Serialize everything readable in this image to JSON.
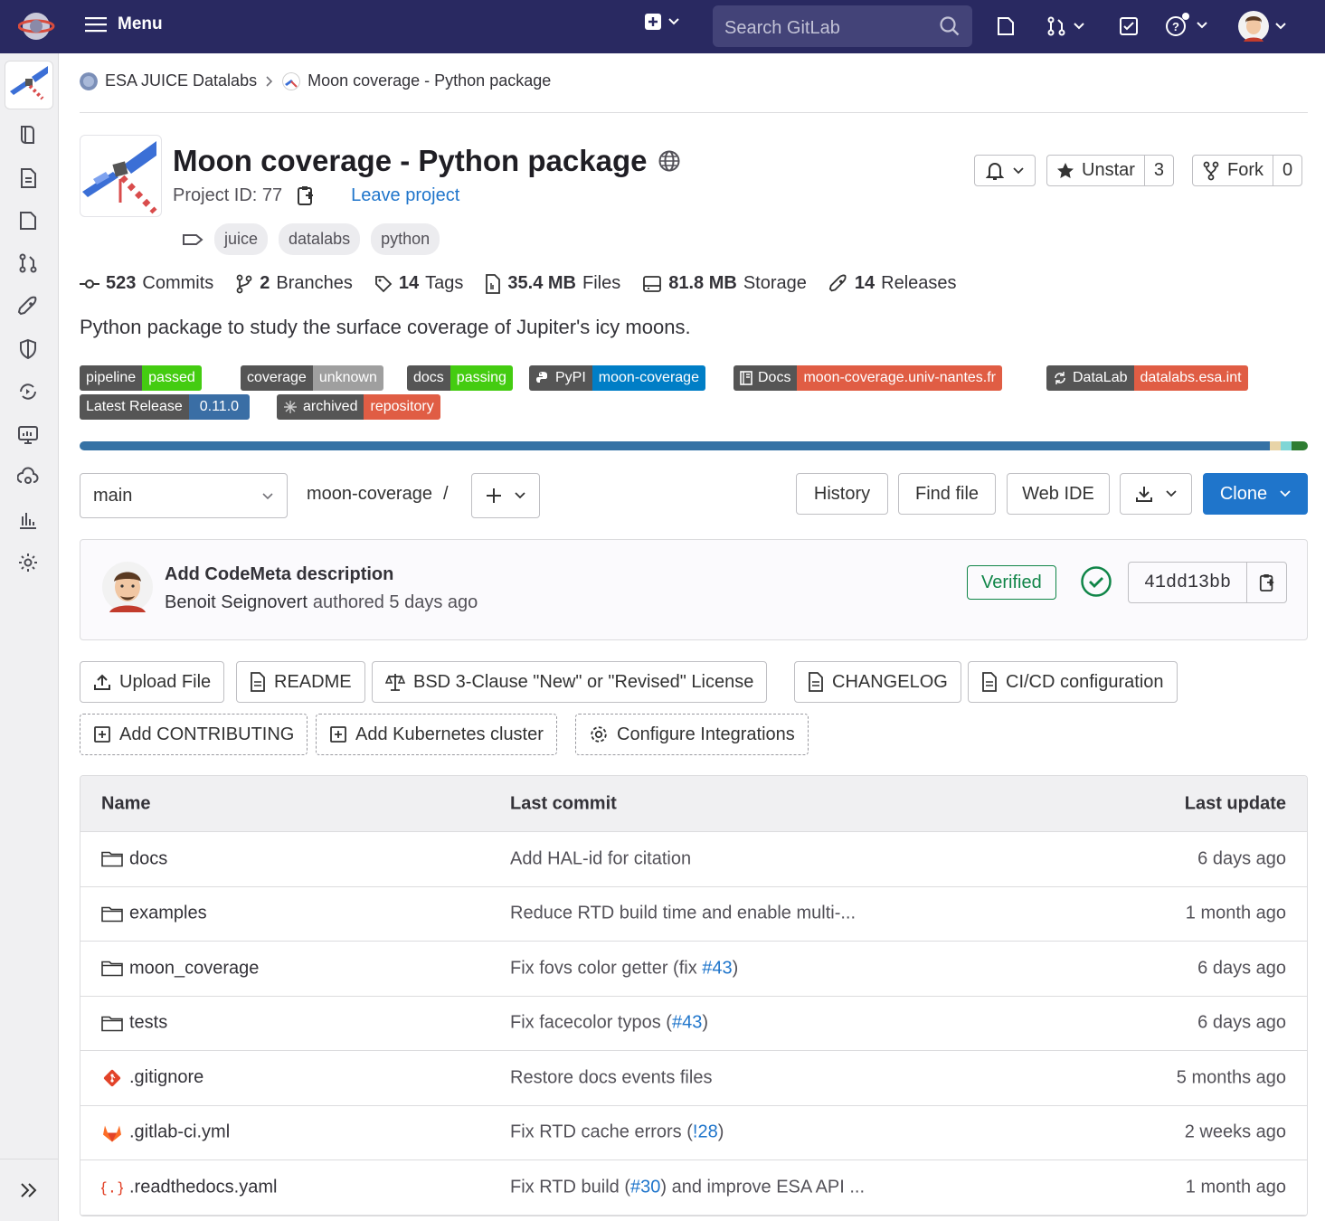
{
  "topbar": {
    "menu_label": "Menu",
    "search_placeholder": "Search GitLab"
  },
  "breadcrumb": {
    "group": "ESA JUICE Datalabs",
    "project": "Moon coverage - Python package"
  },
  "project": {
    "title": "Moon coverage - Python package",
    "id_label": "Project ID: 77",
    "leave_label": "Leave project",
    "topics": [
      "juice",
      "datalabs",
      "python"
    ],
    "unstar_label": "Unstar",
    "star_count": "3",
    "fork_label": "Fork",
    "fork_count": "0",
    "description": "Python package to study the surface coverage of Jupiter's icy moons."
  },
  "stats": [
    {
      "value": "523",
      "label": "Commits",
      "icon": "commit-icon"
    },
    {
      "value": "2",
      "label": "Branches",
      "icon": "branch-icon"
    },
    {
      "value": "14",
      "label": "Tags",
      "icon": "tag-icon"
    },
    {
      "value": "35.4 MB",
      "label": "Files",
      "icon": "file-icon"
    },
    {
      "value": "81.8 MB",
      "label": "Storage",
      "icon": "storage-icon"
    },
    {
      "value": "14",
      "label": "Releases",
      "icon": "rocket-icon"
    }
  ],
  "badges": [
    {
      "left": "pipeline",
      "right": "passed",
      "color": "#4c1"
    },
    {
      "left": "coverage",
      "right": "unknown",
      "color": "#9f9f9f"
    },
    {
      "left": "docs",
      "right": "passing",
      "color": "#4c1"
    },
    {
      "left": "PyPI",
      "right": "moon-coverage",
      "color": "#007ec6"
    },
    {
      "left": "Docs",
      "right": "moon-coverage.univ-nantes.fr",
      "color": "#e05d44"
    },
    {
      "left": "DataLab",
      "right": "datalabs.esa.int",
      "color": "#e05d44"
    },
    {
      "left": "Latest Release",
      "right": "0.11.0",
      "color": "#3a6ea5"
    },
    {
      "left": "archived",
      "right": "repository",
      "color": "#e05d44"
    }
  ],
  "language_bar_colors": [
    "#3572a5",
    "#e8d4a8",
    "#7fd6d6",
    "#2e7d32"
  ],
  "repo": {
    "branch": "main",
    "path": "moon-coverage",
    "path_sep": "/",
    "history_label": "History",
    "find_file_label": "Find file",
    "web_ide_label": "Web IDE",
    "clone_label": "Clone"
  },
  "last_commit": {
    "title": "Add CodeMeta description",
    "author": "Benoit Seignovert",
    "meta": "authored 5 days ago",
    "verified_label": "Verified",
    "sha": "41dd13bb"
  },
  "quick_actions": [
    {
      "label": "Upload File",
      "icon": "upload-icon"
    },
    {
      "label": "README",
      "icon": "doc-icon"
    },
    {
      "label": "BSD 3-Clause \"New\" or \"Revised\" License",
      "icon": "scale-icon"
    },
    {
      "label": "CHANGELOG",
      "icon": "doc-icon"
    },
    {
      "label": "CI/CD configuration",
      "icon": "doc-icon"
    },
    {
      "label": "Add CONTRIBUTING",
      "icon": "plus-square-icon"
    },
    {
      "label": "Add Kubernetes cluster",
      "icon": "plus-square-icon"
    },
    {
      "label": "Configure Integrations",
      "icon": "gear-icon"
    }
  ],
  "table": {
    "headers": [
      "Name",
      "Last commit",
      "Last update"
    ],
    "rows": [
      {
        "name": "docs",
        "type": "folder",
        "commit": "Add HAL-id for citation",
        "ref": "",
        "commit_tail": "",
        "updated": "6 days ago"
      },
      {
        "name": "examples",
        "type": "folder",
        "commit": "Reduce RTD build time and enable multi-...",
        "ref": "",
        "commit_tail": "",
        "updated": "1 month ago"
      },
      {
        "name": "moon_coverage",
        "type": "folder",
        "commit": "Fix fovs color getter (fix ",
        "ref": "#43",
        "commit_tail": ")",
        "updated": "6 days ago"
      },
      {
        "name": "tests",
        "type": "folder",
        "commit": "Fix facecolor typos (",
        "ref": "#43",
        "commit_tail": ")",
        "updated": "6 days ago"
      },
      {
        "name": ".gitignore",
        "type": "git",
        "commit": "Restore docs events files",
        "ref": "",
        "commit_tail": "",
        "updated": "5 months ago"
      },
      {
        "name": ".gitlab-ci.yml",
        "type": "gitlab",
        "commit": "Fix RTD cache errors (",
        "ref": "!28",
        "commit_tail": ")",
        "updated": "2 weeks ago"
      },
      {
        "name": ".readthedocs.yaml",
        "type": "yaml",
        "commit": "Fix RTD build (",
        "ref": "#30",
        "commit_tail": ") and improve ESA API ...",
        "updated": "1 month ago"
      }
    ]
  }
}
